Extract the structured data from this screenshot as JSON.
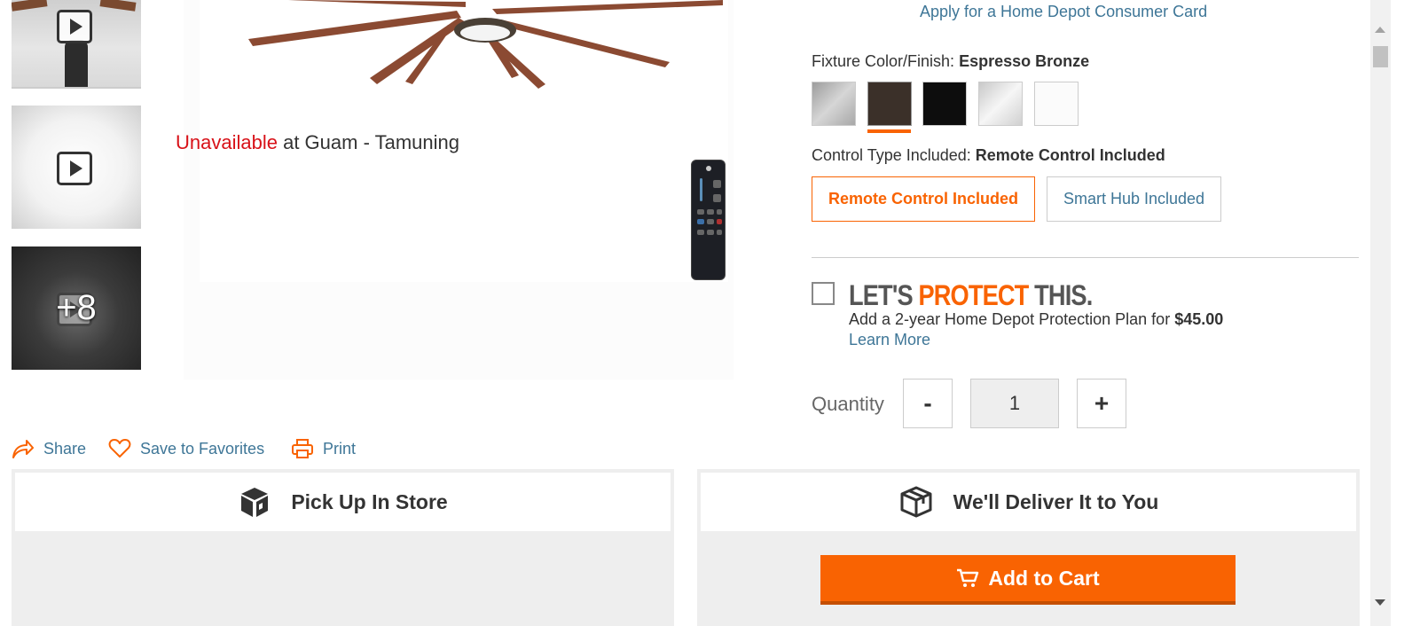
{
  "gallery": {
    "more_count": "+8"
  },
  "consumer_card": {
    "link_label": "Apply for a Home Depot Consumer Card"
  },
  "finish": {
    "label": "Fixture Color/Finish:",
    "selected": "Espresso Bronze",
    "swatch_colors": [
      "#b9b9b9",
      "#3b3029",
      "#0d0d0d",
      "#e2e2e2",
      "#fbfbfb"
    ],
    "selected_index": 1
  },
  "control_type": {
    "label": "Control Type Included:",
    "selected": "Remote Control Included",
    "options": [
      "Remote Control Included",
      "Smart Hub Included"
    ]
  },
  "protection": {
    "title_part1": "LET'S",
    "title_part2": "PROTECT",
    "title_part3": "THIS.",
    "description": "Add a 2-year Home Depot Protection Plan for",
    "price": "$45.00",
    "learn_more": "Learn More"
  },
  "quantity": {
    "label": "Quantity",
    "minus": "-",
    "value": "1",
    "plus": "+"
  },
  "actions": {
    "share": "Share",
    "save": "Save to Favorites",
    "print": "Print"
  },
  "pickup": {
    "title": "Pick Up In Store",
    "status": "Unavailable",
    "store_text": "at Guam - Tamuning"
  },
  "delivery": {
    "title": "We'll Deliver It to You",
    "add_to_cart": "Add to Cart"
  },
  "colors": {
    "brand_orange": "#f96302",
    "link_blue": "#3e7697",
    "unavailable_red": "#d81118"
  }
}
